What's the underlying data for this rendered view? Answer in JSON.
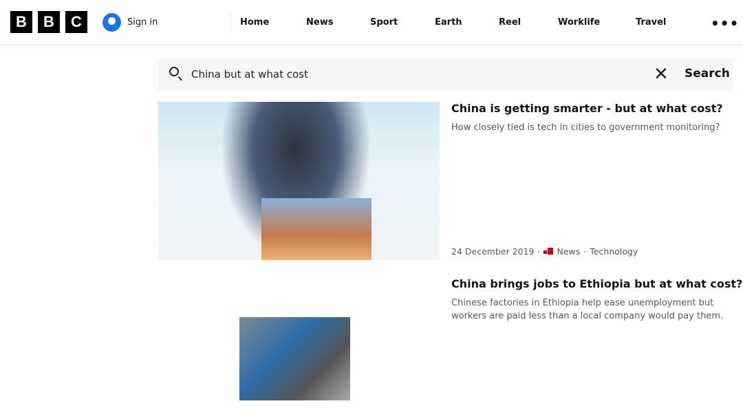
{
  "header": {
    "logo": "BBC",
    "sign_in": "Sign in",
    "nav": [
      "Home",
      "News",
      "Sport",
      "Earth",
      "Reel",
      "Worklife",
      "Travel"
    ],
    "more_icon": "ellipsis-icon"
  },
  "search": {
    "value": "China but at what cost",
    "button": "Search"
  },
  "results": [
    {
      "title": "China is getting smarter - but at what cost?",
      "summary": "How closely tied is tech in cities to government monitoring?",
      "date": "24 December 2019",
      "section": "News",
      "topic": "Technology",
      "separator": "·"
    },
    {
      "title": "China brings jobs to Ethiopia but at what cost?",
      "summary": "Chinese factories in Ethiopia help ease unemployment but workers are paid less than a local company would pay them."
    }
  ],
  "colors": {
    "accent": "#1a73e8",
    "news_red": "#d9000d"
  }
}
